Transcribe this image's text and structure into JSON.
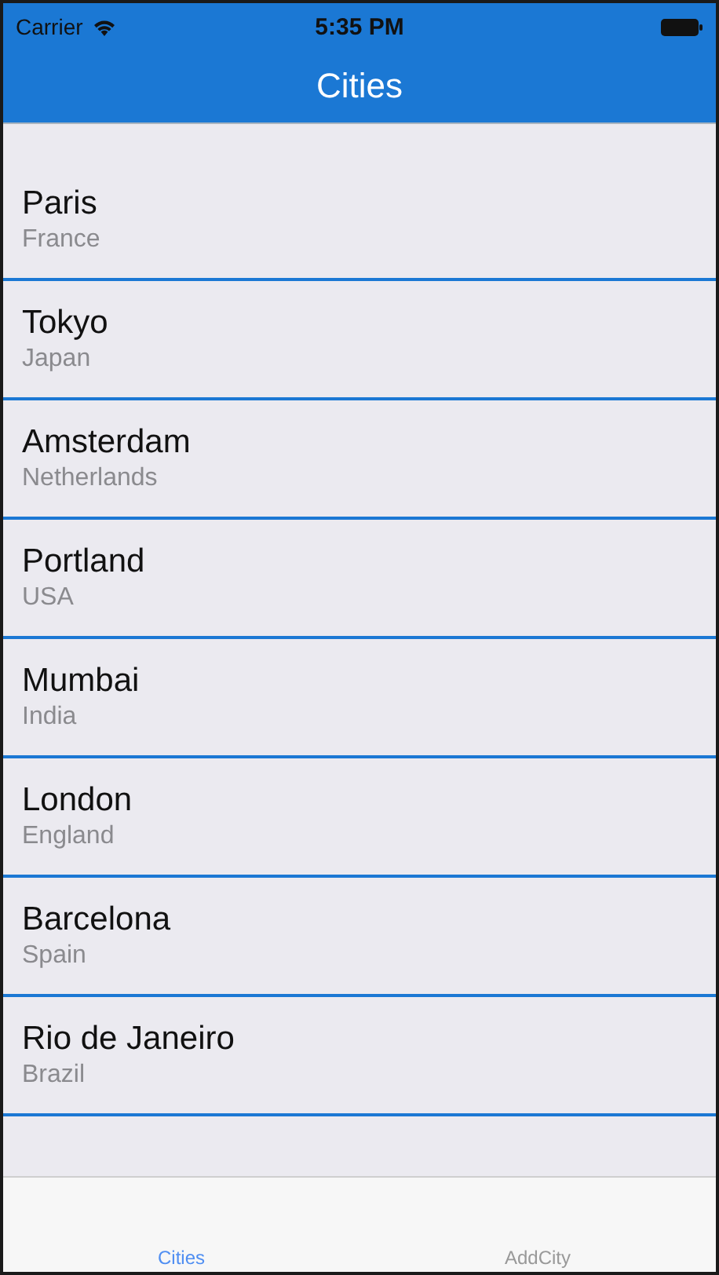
{
  "status_bar": {
    "carrier": "Carrier",
    "time": "5:35 PM"
  },
  "nav_bar": {
    "title": "Cities"
  },
  "cities": [
    {
      "name": "Paris",
      "country": "France"
    },
    {
      "name": "Tokyo",
      "country": "Japan"
    },
    {
      "name": "Amsterdam",
      "country": "Netherlands"
    },
    {
      "name": "Portland",
      "country": "USA"
    },
    {
      "name": "Mumbai",
      "country": "India"
    },
    {
      "name": "London",
      "country": "England"
    },
    {
      "name": "Barcelona",
      "country": "Spain"
    },
    {
      "name": "Rio de Janeiro",
      "country": "Brazil"
    }
  ],
  "tabs": [
    {
      "label": "Cities",
      "selected": true
    },
    {
      "label": "AddCity",
      "selected": false
    }
  ]
}
